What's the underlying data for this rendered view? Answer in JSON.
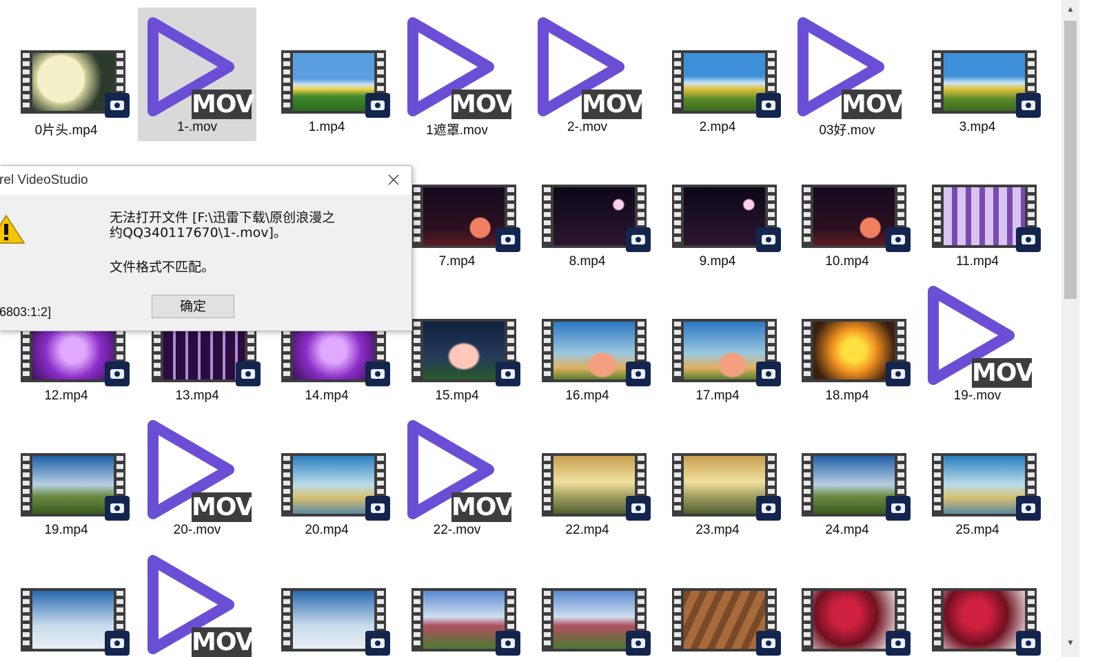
{
  "files": [
    {
      "name": "0片头.mp4",
      "type": "mp4",
      "theme": "moon"
    },
    {
      "name": "1-.mov",
      "type": "mov",
      "selected": true
    },
    {
      "name": "1.mp4",
      "type": "mp4",
      "theme": "grass"
    },
    {
      "name": "1遮罩.mov",
      "type": "mov"
    },
    {
      "name": "2-.mov",
      "type": "mov"
    },
    {
      "name": "2.mp4",
      "type": "mp4",
      "theme": "field"
    },
    {
      "name": "03好.mov",
      "type": "mov"
    },
    {
      "name": "3.mp4",
      "type": "mp4",
      "theme": "field"
    },
    {
      "name": "",
      "type": "hidden"
    },
    {
      "name": "",
      "type": "hidden"
    },
    {
      "name": "",
      "type": "hidden"
    },
    {
      "name": "7.mp4",
      "type": "mp4",
      "theme": "nightflower"
    },
    {
      "name": "8.mp4",
      "type": "mp4",
      "theme": "night"
    },
    {
      "name": "9.mp4",
      "type": "mp4",
      "theme": "night"
    },
    {
      "name": "10.mp4",
      "type": "mp4",
      "theme": "nightflower"
    },
    {
      "name": "11.mp4",
      "type": "mp4",
      "theme": "purplearch"
    },
    {
      "name": "12.mp4",
      "type": "mp4",
      "theme": "purple"
    },
    {
      "name": "13.mp4",
      "type": "mp4",
      "theme": "purplenight"
    },
    {
      "name": "14.mp4",
      "type": "mp4",
      "theme": "purple"
    },
    {
      "name": "15.mp4",
      "type": "mp4",
      "theme": "lotus"
    },
    {
      "name": "16.mp4",
      "type": "mp4",
      "theme": "lily"
    },
    {
      "name": "17.mp4",
      "type": "mp4",
      "theme": "lily"
    },
    {
      "name": "18.mp4",
      "type": "mp4",
      "theme": "yellowflower"
    },
    {
      "name": "19-.mov",
      "type": "mov"
    },
    {
      "name": "19.mp4",
      "type": "mp4",
      "theme": "castle"
    },
    {
      "name": "20-.mov",
      "type": "mov"
    },
    {
      "name": "20.mp4",
      "type": "mp4",
      "theme": "sea"
    },
    {
      "name": "22-.mov",
      "type": "mov"
    },
    {
      "name": "22.mp4",
      "type": "mp4",
      "theme": "golden"
    },
    {
      "name": "23.mp4",
      "type": "mp4",
      "theme": "golden"
    },
    {
      "name": "24.mp4",
      "type": "mp4",
      "theme": "castle"
    },
    {
      "name": "25.mp4",
      "type": "mp4",
      "theme": "sea"
    },
    {
      "name": "",
      "type": "mp4",
      "theme": "cloud"
    },
    {
      "name": "",
      "type": "mov"
    },
    {
      "name": "",
      "type": "mp4",
      "theme": "cloud"
    },
    {
      "name": "",
      "type": "mp4",
      "theme": "garden"
    },
    {
      "name": "",
      "type": "mp4",
      "theme": "garden"
    },
    {
      "name": "",
      "type": "mp4",
      "theme": "wood"
    },
    {
      "name": "",
      "type": "mp4",
      "theme": "blossom"
    },
    {
      "name": "",
      "type": "mp4",
      "theme": "blossom"
    }
  ],
  "mov_badge": "MOV",
  "colors": {
    "mov_play": "#6a4fd6",
    "badge": "#13244d",
    "selected": "#d9d9d9"
  },
  "dialog": {
    "title": "rel VideoStudio",
    "message_line1": "无法打开文件 [F:\\迅雷下载\\原创浪漫之",
    "message_line2": "约QQ340117670\\1-.mov]。",
    "message_line3": "文件格式不匹配。",
    "code": "6803:1:2]",
    "ok_label": "确定",
    "icon": "warning-icon"
  },
  "scrollbar": {
    "up": "▲",
    "down": "▼"
  }
}
